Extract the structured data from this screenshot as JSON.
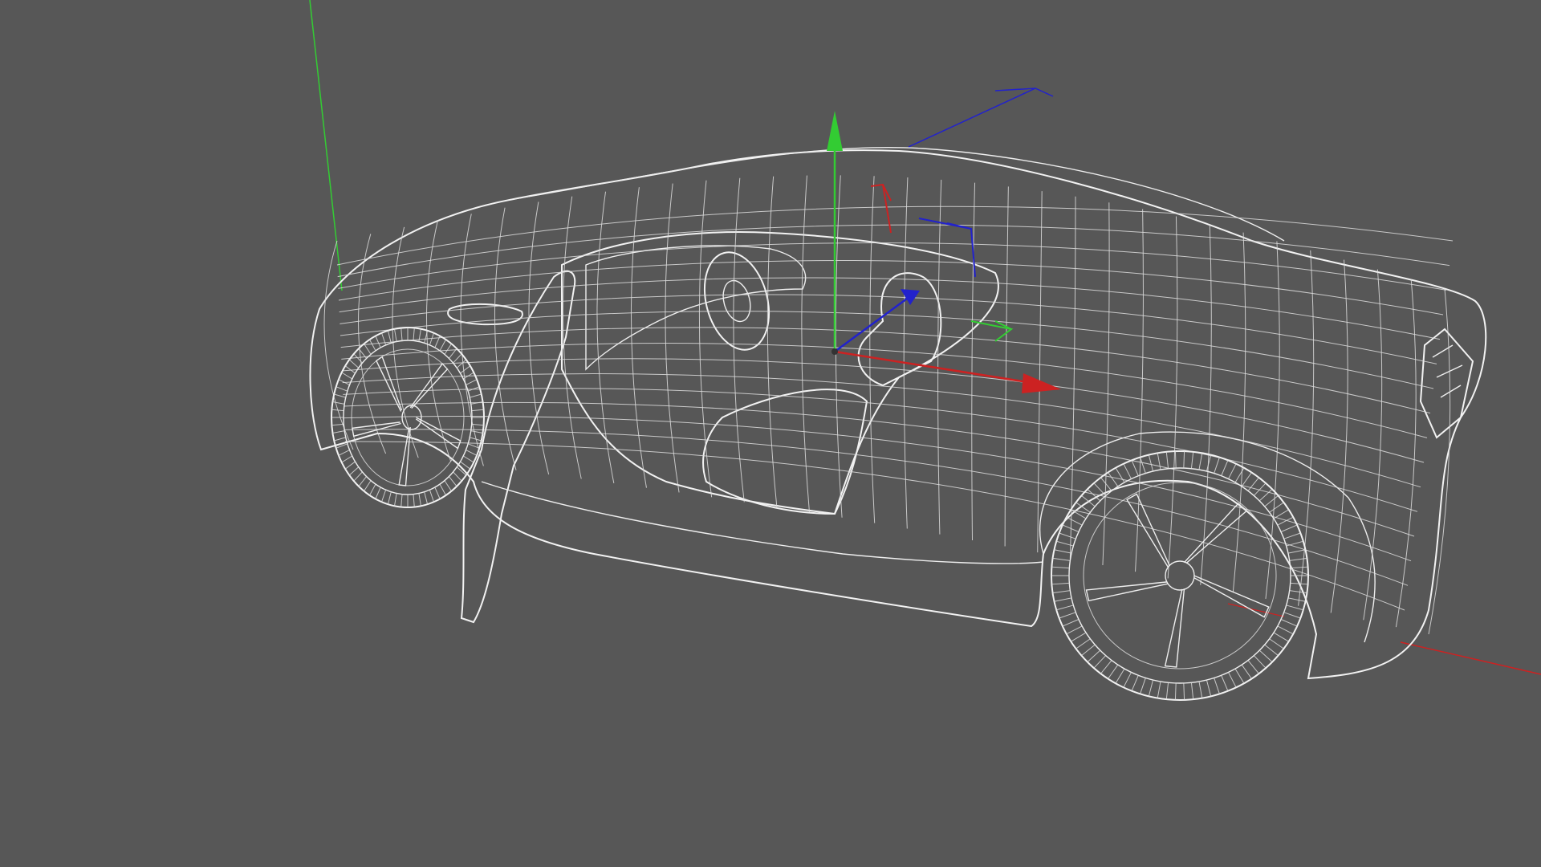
{
  "viewport": {
    "background": "#575757",
    "wire_color": "#eeeeee",
    "axis_colors": {
      "x": "#cc2222",
      "y": "#33cc33",
      "z": "#2222cc"
    },
    "icons": {
      "world_axis_x": "world-x-axis-line",
      "world_axis_y": "world-y-axis-line",
      "gizmo": "move-gizmo-icon",
      "secondary_gizmo": "pivot-gizmo-icon"
    }
  }
}
